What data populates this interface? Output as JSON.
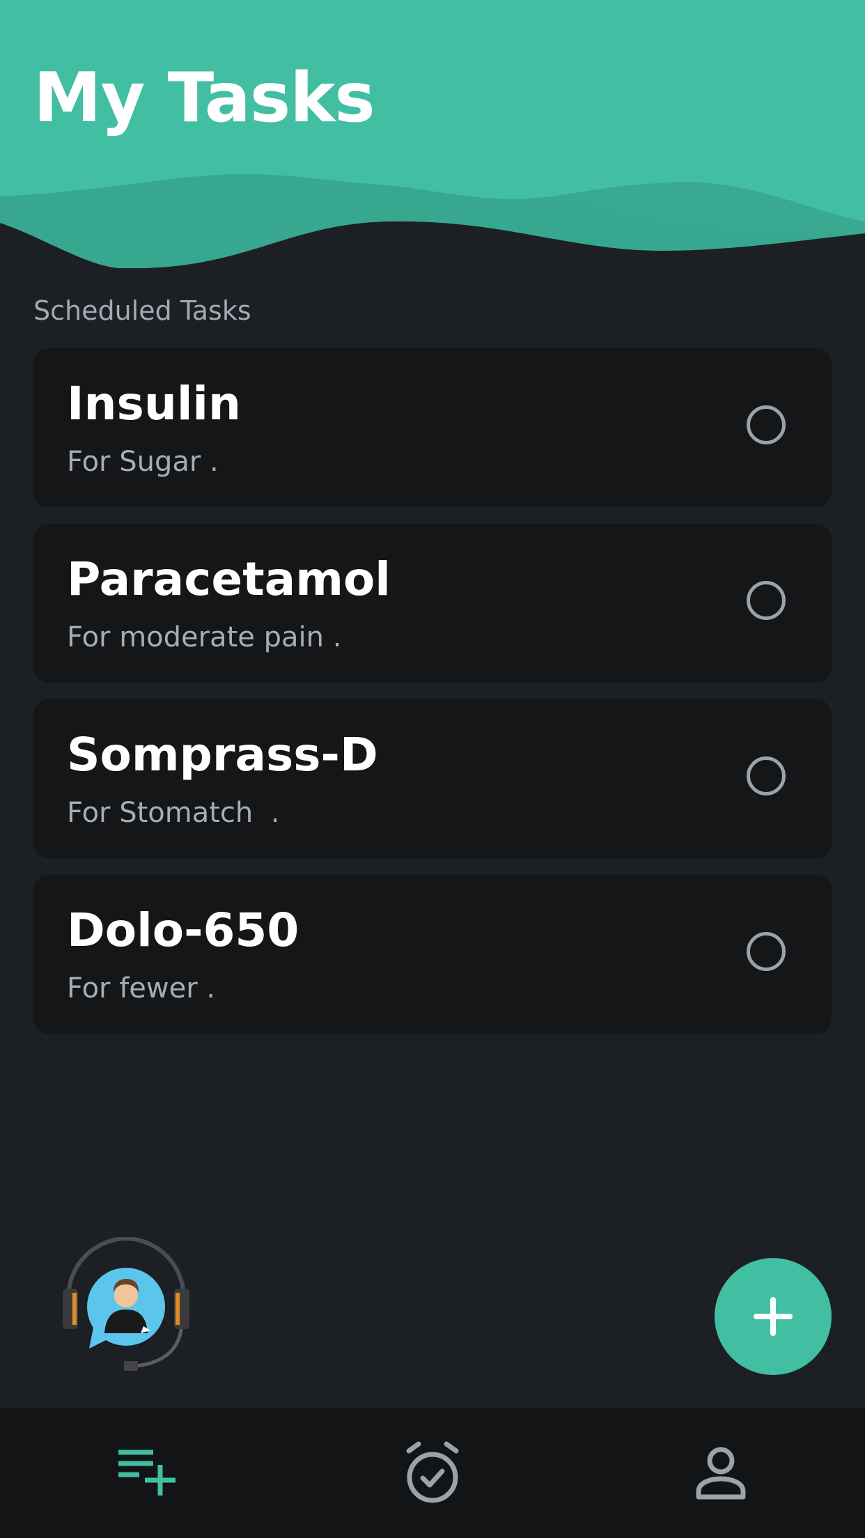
{
  "header": {
    "title": "My Tasks"
  },
  "section": {
    "label": "Scheduled Tasks"
  },
  "tasks": [
    {
      "name": "Insulin",
      "description": "For Sugar ."
    },
    {
      "name": "Paracetamol",
      "description": "For moderate pain ."
    },
    {
      "name": "Somprass-D",
      "description": "For Stomatch  ."
    },
    {
      "name": "Dolo-650",
      "description": "For fewer ."
    }
  ],
  "fab": {
    "icon": "plus-icon"
  },
  "support": {
    "icon": "customer-support-icon"
  },
  "bottom_nav": {
    "items": [
      {
        "icon": "playlist-add-icon",
        "active": true
      },
      {
        "icon": "alarm-check-icon",
        "active": false
      },
      {
        "icon": "person-icon",
        "active": false
      }
    ]
  },
  "colors": {
    "accent": "#42bfa3",
    "background": "#1c1f23",
    "card": "#141618",
    "nav_background": "#121416",
    "muted_text": "#a3aab3"
  }
}
